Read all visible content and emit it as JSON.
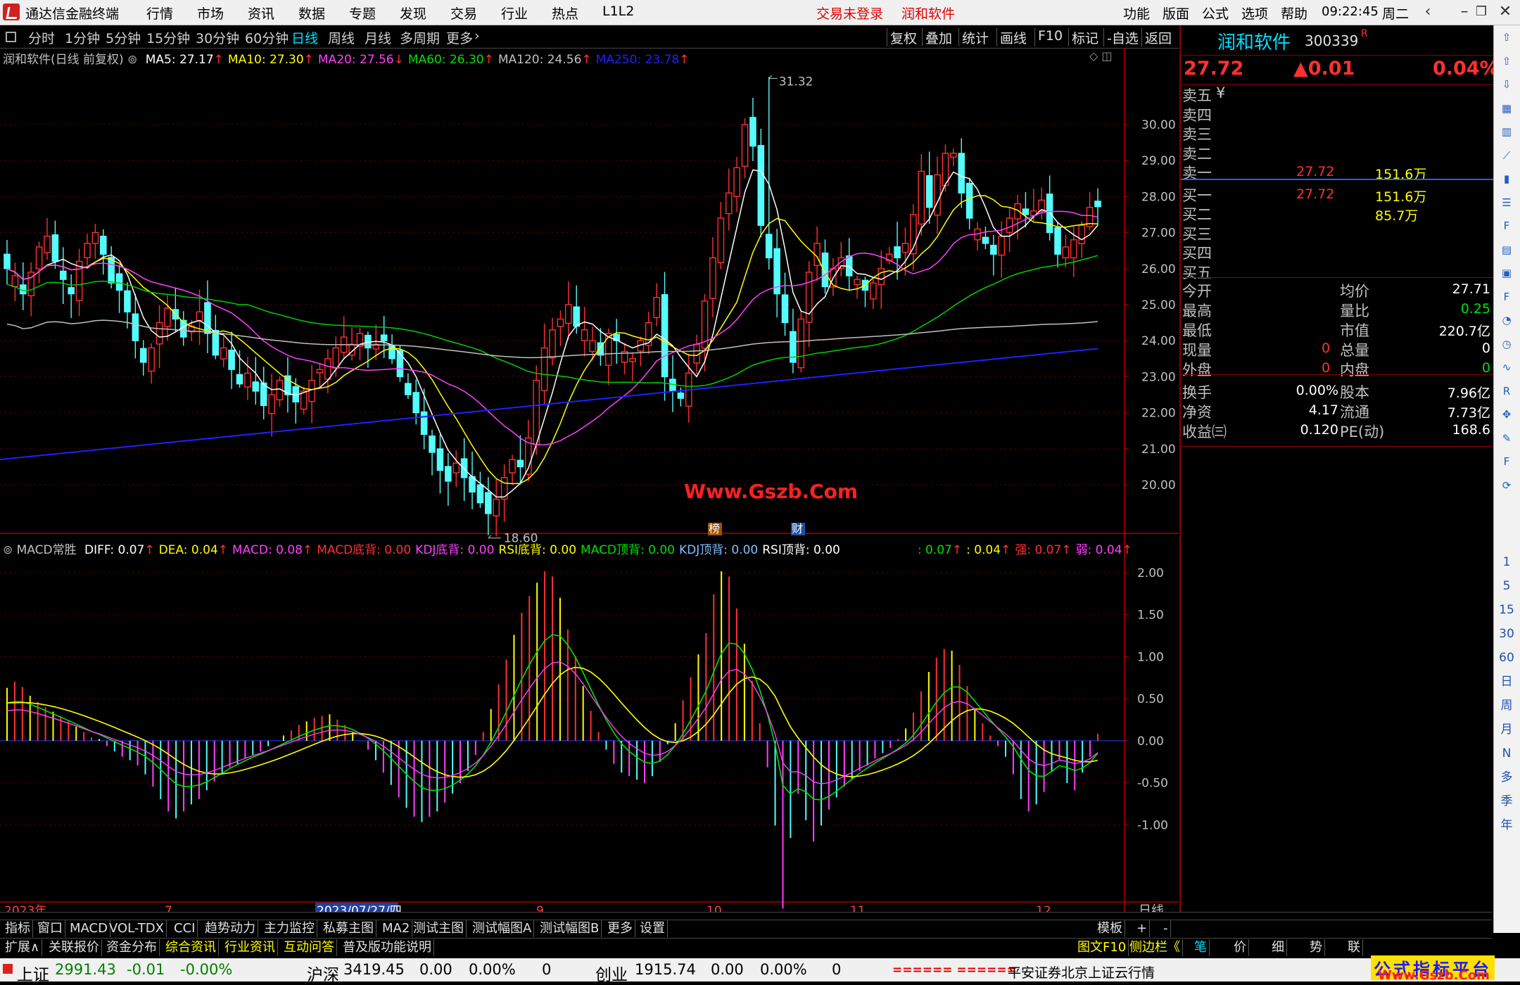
{
  "window": {
    "app_name": "通达信金融终端",
    "menus": [
      "行情",
      "市场",
      "资讯",
      "数据",
      "专题",
      "发现",
      "交易",
      "行业",
      "热点",
      "L1L2"
    ],
    "login_status": "交易未登录",
    "stock_label": "润和软件",
    "right_menus": [
      "功能",
      "版面",
      "公式",
      "选项",
      "帮助"
    ],
    "time": "09:22:45",
    "weekday": "周二"
  },
  "toolbar": {
    "periods": [
      "分时",
      "1分钟",
      "5分钟",
      "15分钟",
      "30分钟",
      "60分钟",
      "日线",
      "周线",
      "月线",
      "多周期",
      "更多"
    ],
    "active_period": "日线",
    "right_buttons": [
      "复权",
      "叠加",
      "统计",
      "画线",
      "F10",
      "标记",
      "-自选",
      "返回"
    ]
  },
  "legend": {
    "title": "润和软件(日线 前复权)",
    "ma": [
      {
        "label": "MA5: 27.17",
        "arrow": "↑",
        "color": "#ffffff"
      },
      {
        "label": "MA10: 27.30",
        "arrow": "↑",
        "color": "#ffff00"
      },
      {
        "label": "MA20: 27.56",
        "arrow": "↓",
        "color": "#ff40ff"
      },
      {
        "label": "MA60: 26.30",
        "arrow": "↑",
        "color": "#00e000"
      },
      {
        "label": "MA120: 24.56",
        "arrow": "↑",
        "color": "#c0c0c0"
      },
      {
        "label": "MA250: 23.78",
        "arrow": "↑",
        "color": "#2020ff"
      }
    ]
  },
  "macd_legend": {
    "title": "MACD常胜",
    "items": [
      {
        "label": "DIFF: 0.07",
        "arrow": "↑",
        "color": "#ffffff"
      },
      {
        "label": "DEA: 0.04",
        "arrow": "↑",
        "color": "#ffff00"
      },
      {
        "label": "MACD: 0.08",
        "arrow": "↑",
        "color": "#ff40ff"
      },
      {
        "label": "MACD底背: 0.00",
        "arrow": "",
        "color": "#ff3030"
      },
      {
        "label": "KDJ底背: 0.00",
        "arrow": "",
        "color": "#ff40ff"
      },
      {
        "label": "RSI底背: 0.00",
        "arrow": "",
        "color": "#ffff00"
      },
      {
        "label": "MACD顶背: 0.00",
        "arrow": "",
        "color": "#00e000"
      },
      {
        "label": "KDJ顶背: 0.00",
        "arrow": "",
        "color": "#80c0ff"
      },
      {
        "label": "RSI顶背: 0.00",
        "arrow": "",
        "color": "#ffffff"
      },
      {
        "label": ": 0.07",
        "arrow": "↑",
        "color": "#00e000"
      },
      {
        "label": ": 0.04",
        "arrow": "↑",
        "color": "#ffff00"
      },
      {
        "label": "强: 0.07",
        "arrow": "↑",
        "color": "#ff3030"
      },
      {
        "label": "弱: 0.04",
        "arrow": "↑",
        "color": "#ff40ff"
      }
    ]
  },
  "chart_data": [
    {
      "type": "candlestick",
      "title": "润和软件(日线 前复权)",
      "y_ticks": [
        20.0,
        21.0,
        22.0,
        23.0,
        24.0,
        25.0,
        26.0,
        27.0,
        28.0,
        29.0,
        30.0
      ],
      "ylim": [
        19.2,
        31.6
      ],
      "high_label": "31.32",
      "low_label": "18.60",
      "watermark": "Www.Gszb.Com",
      "markers": [
        "榜",
        "财"
      ],
      "closes": [
        26.0,
        25.8,
        25.3,
        25.9,
        26.6,
        26.9,
        26.2,
        25.7,
        25.3,
        26.2,
        26.7,
        27.0,
        26.4,
        25.6,
        25.4,
        24.8,
        24.0,
        23.4,
        23.8,
        24.5,
        24.9,
        24.6,
        24.1,
        24.4,
        24.8,
        24.2,
        23.6,
        23.8,
        23.2,
        22.8,
        23.1,
        22.6,
        22.2,
        22.5,
        22.9,
        22.5,
        22.3,
        22.6,
        22.9,
        23.2,
        23.5,
        23.8,
        24.1,
        23.9,
        24.2,
        23.8,
        23.9,
        24.0,
        23.5,
        23.0,
        22.5,
        22.0,
        21.4,
        20.9,
        20.4,
        20.1,
        20.6,
        20.2,
        19.8,
        19.5,
        19.2,
        19.6,
        20.2,
        20.7,
        20.5,
        21.3,
        22.9,
        23.8,
        24.3,
        24.6,
        25.0,
        24.4,
        24.3,
        24.0,
        23.6,
        24.2,
        24.0,
        23.7,
        23.5,
        24.0,
        24.5,
        25.2,
        23.0,
        22.6,
        22.4,
        23.1,
        23.9,
        25.1,
        26.3,
        27.4,
        28.1,
        28.8,
        30.0,
        29.4,
        27.2,
        26.3,
        25.3,
        24.5,
        23.4,
        24.6,
        25.9,
        26.7,
        25.5,
        26.0,
        26.3,
        25.8,
        25.7,
        25.4,
        25.6,
        26.0,
        26.4,
        26.3,
        26.7,
        27.5,
        28.7,
        27.7,
        28.6,
        29.2,
        29.2,
        28.1,
        27.4,
        27.1,
        26.7,
        26.4,
        26.9,
        27.4,
        27.8,
        27.5,
        27.6,
        27.9,
        27.0,
        26.4,
        26.6,
        26.8,
        27.2,
        27.7,
        27.72
      ]
    },
    {
      "type": "bar",
      "title": "MACD常胜",
      "y_ticks": [
        -1.0,
        -0.5,
        0.0,
        0.5,
        1.0,
        1.5,
        2.0
      ],
      "ylim": [
        -1.9,
        2.2
      ],
      "values": [
        0.6,
        0.67,
        0.61,
        0.51,
        0.44,
        0.38,
        0.33,
        0.28,
        0.22,
        0.16,
        0.1,
        0.04,
        0.02,
        -0.06,
        -0.12,
        -0.18,
        -0.22,
        -0.28,
        -0.38,
        -0.52,
        -0.66,
        -0.8,
        -0.88,
        -0.8,
        -0.72,
        -0.66,
        -0.56,
        -0.46,
        -0.38,
        -0.3,
        -0.26,
        -0.2,
        -0.16,
        -0.12,
        -0.06,
        0.0,
        0.06,
        0.12,
        0.18,
        0.22,
        0.26,
        0.28,
        0.3,
        0.24,
        0.18,
        0.1,
        0.0,
        -0.1,
        -0.22,
        -0.36,
        -0.5,
        -0.64,
        -0.76,
        -0.86,
        -0.92,
        -0.86,
        -0.8,
        -0.7,
        -0.6,
        -0.48,
        -0.34,
        -0.16,
        0.1,
        0.36,
        0.64,
        0.92,
        1.2,
        1.45,
        1.64,
        1.79,
        1.92,
        1.86,
        1.62,
        1.26,
        0.96,
        0.62,
        0.34,
        0.1,
        -0.1,
        -0.26,
        -0.36,
        -0.4,
        -0.44,
        -0.48,
        -0.4,
        -0.24,
        -0.04,
        0.2,
        0.46,
        0.72,
        0.98,
        1.22,
        1.66,
        1.92,
        1.86,
        1.5,
        1.1,
        0.68,
        0.2,
        -0.3,
        -0.96,
        -1.9,
        -1.1,
        -0.6,
        -0.9,
        -1.14,
        -0.96,
        -0.78,
        -0.64,
        -0.52,
        -0.44,
        -0.34,
        -0.28,
        -0.2,
        -0.14,
        -0.08,
        0.02,
        0.14,
        0.32,
        0.56,
        0.78,
        0.94,
        1.04,
        1.02,
        0.86,
        0.62,
        0.36,
        0.2,
        0.06,
        -0.06,
        -0.18,
        -0.38,
        -0.66,
        -0.8,
        -0.72,
        -0.58,
        -0.34,
        -0.22,
        -0.48,
        -0.56,
        -0.36,
        -0.18,
        0.08
      ]
    }
  ],
  "x_axis": {
    "labels": [
      "2023年",
      "7",
      "2023/07/27/四",
      "9",
      "10",
      "11",
      "12"
    ],
    "period_label": "日线"
  },
  "quote": {
    "name": "润和软件",
    "code": "300339",
    "flag": "R",
    "price": "27.72",
    "change": "▲0.01",
    "pct": "0.04%",
    "asks": [
      {
        "label": "卖五",
        "price": "",
        "vol": "",
        "suffix": "¥"
      },
      {
        "label": "卖四",
        "price": "",
        "vol": ""
      },
      {
        "label": "卖三",
        "price": "",
        "vol": ""
      },
      {
        "label": "卖二",
        "price": "",
        "vol": ""
      },
      {
        "label": "卖一",
        "price": "27.72",
        "vol": "151.6万"
      }
    ],
    "bids": [
      {
        "label": "买一",
        "price": "27.72",
        "vol": "151.6万"
      },
      {
        "label": "买二",
        "price": "",
        "vol": "85.7万"
      },
      {
        "label": "买三",
        "price": "",
        "vol": ""
      },
      {
        "label": "买四",
        "price": "",
        "vol": ""
      },
      {
        "label": "买五",
        "price": "",
        "vol": ""
      }
    ],
    "stats": [
      {
        "l1": "今开",
        "v1": "",
        "l2": "均价",
        "v2": "27.71",
        "c2": "#ffffff"
      },
      {
        "l1": "最高",
        "v1": "",
        "l2": "量比",
        "v2": "0.25",
        "c2": "#00e000"
      },
      {
        "l1": "最低",
        "v1": "",
        "l2": "市值",
        "v2": "220.7亿",
        "c2": "#ffffff"
      },
      {
        "l1": "现量",
        "v1": "0",
        "c1": "#ff3030",
        "l2": "总量",
        "v2": "0",
        "c2": "#ffffff"
      },
      {
        "l1": "外盘",
        "v1": "0",
        "c1": "#ff3030",
        "l2": "内盘",
        "v2": "0",
        "c2": "#00e000"
      }
    ],
    "stats2": [
      {
        "l1": "换手",
        "v1": "0.00%",
        "l2": "股本",
        "v2": "7.96亿"
      },
      {
        "l1": "净资",
        "v1": "4.17",
        "l2": "流通",
        "v2": "7.73亿"
      },
      {
        "l1": "收益㈢",
        "v1": "0.120",
        "l2": "PE(动)",
        "v2": "168.6"
      }
    ]
  },
  "bottom_tabs_1": [
    "指标",
    "窗口",
    "MACD",
    "VOL-TDX",
    "CCI",
    "趋势动力",
    "主力监控",
    "私募主图",
    "MA2",
    "测试主图",
    "测试幅图A",
    "测试幅图B",
    "更多",
    "设置"
  ],
  "bottom_tabs_1_right": [
    "模板",
    "+",
    "-"
  ],
  "bottom_tabs_2": [
    "扩展∧",
    "关联报价",
    "资金分布",
    "综合资讯",
    "行业资讯",
    "互动问答",
    "普及版功能说明"
  ],
  "bottom_tabs_2_right": [
    "图文F10",
    "侧边栏《"
  ],
  "bottom_right_tabs": [
    "笔",
    "价",
    "细",
    "势",
    "联"
  ],
  "status": {
    "indices": [
      {
        "name": "上证",
        "value": "2991.43",
        "change": "-0.01",
        "pct": "-0.00%"
      },
      {
        "name": "沪深",
        "value": "3419.45",
        "change": "0.00",
        "pct": "0.00%",
        "vol": "0"
      },
      {
        "name": "创业",
        "value": "1915.74",
        "change": "0.00",
        "pct": "0.00%",
        "vol": "0"
      }
    ],
    "bars": "====== ======",
    "server": "平安证券北京上证云行情",
    "brand": "公式指标平台",
    "brand_url": "Www.Gszb.Com"
  },
  "icons": [
    "arrow-up-icon",
    "arrow-up-outline-icon",
    "arrow-down-outline-icon",
    "grid-icon",
    "table-icon",
    "line-chart-icon",
    "candle-icon",
    "list-icon",
    "f10-icon",
    "table-icon",
    "news-icon",
    "fz-icon",
    "clock-icon",
    "gauge-icon",
    "wave-icon",
    "rsi-icon",
    "move-icon",
    "pen-icon",
    "fs-icon",
    "refresh-icon"
  ],
  "icon_labels": [
    "1",
    "5",
    "15",
    "30",
    "60",
    "日",
    "周",
    "月",
    "N",
    "多",
    "季",
    "年"
  ]
}
